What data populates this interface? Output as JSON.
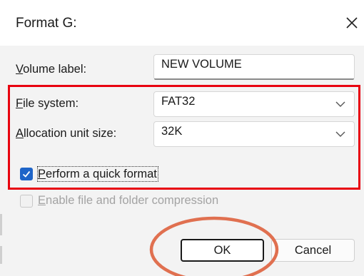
{
  "window": {
    "title": "Format G:"
  },
  "volume_label": {
    "prefix": "V",
    "rest": "olume label:",
    "value": "NEW VOLUME"
  },
  "file_system": {
    "prefix": "F",
    "rest": "ile system:",
    "value": "FAT32"
  },
  "allocation": {
    "prefix": "A",
    "rest": "llocation unit size:",
    "value": "32K"
  },
  "quick_format": {
    "prefix": "P",
    "rest": "erform a quick format",
    "checked": true
  },
  "compression": {
    "prefix": "E",
    "rest": "nable file and folder compression",
    "checked": false,
    "enabled": false
  },
  "buttons": {
    "ok": "OK",
    "cancel": "Cancel"
  },
  "colors": {
    "highlight_box": "#e8000f",
    "highlight_ellipse": "#e07050",
    "checkbox_accent": "#1e64c8"
  },
  "icons": {
    "close": "close-icon",
    "dropdown": "chevron-down-icon",
    "check": "checkmark-icon"
  }
}
